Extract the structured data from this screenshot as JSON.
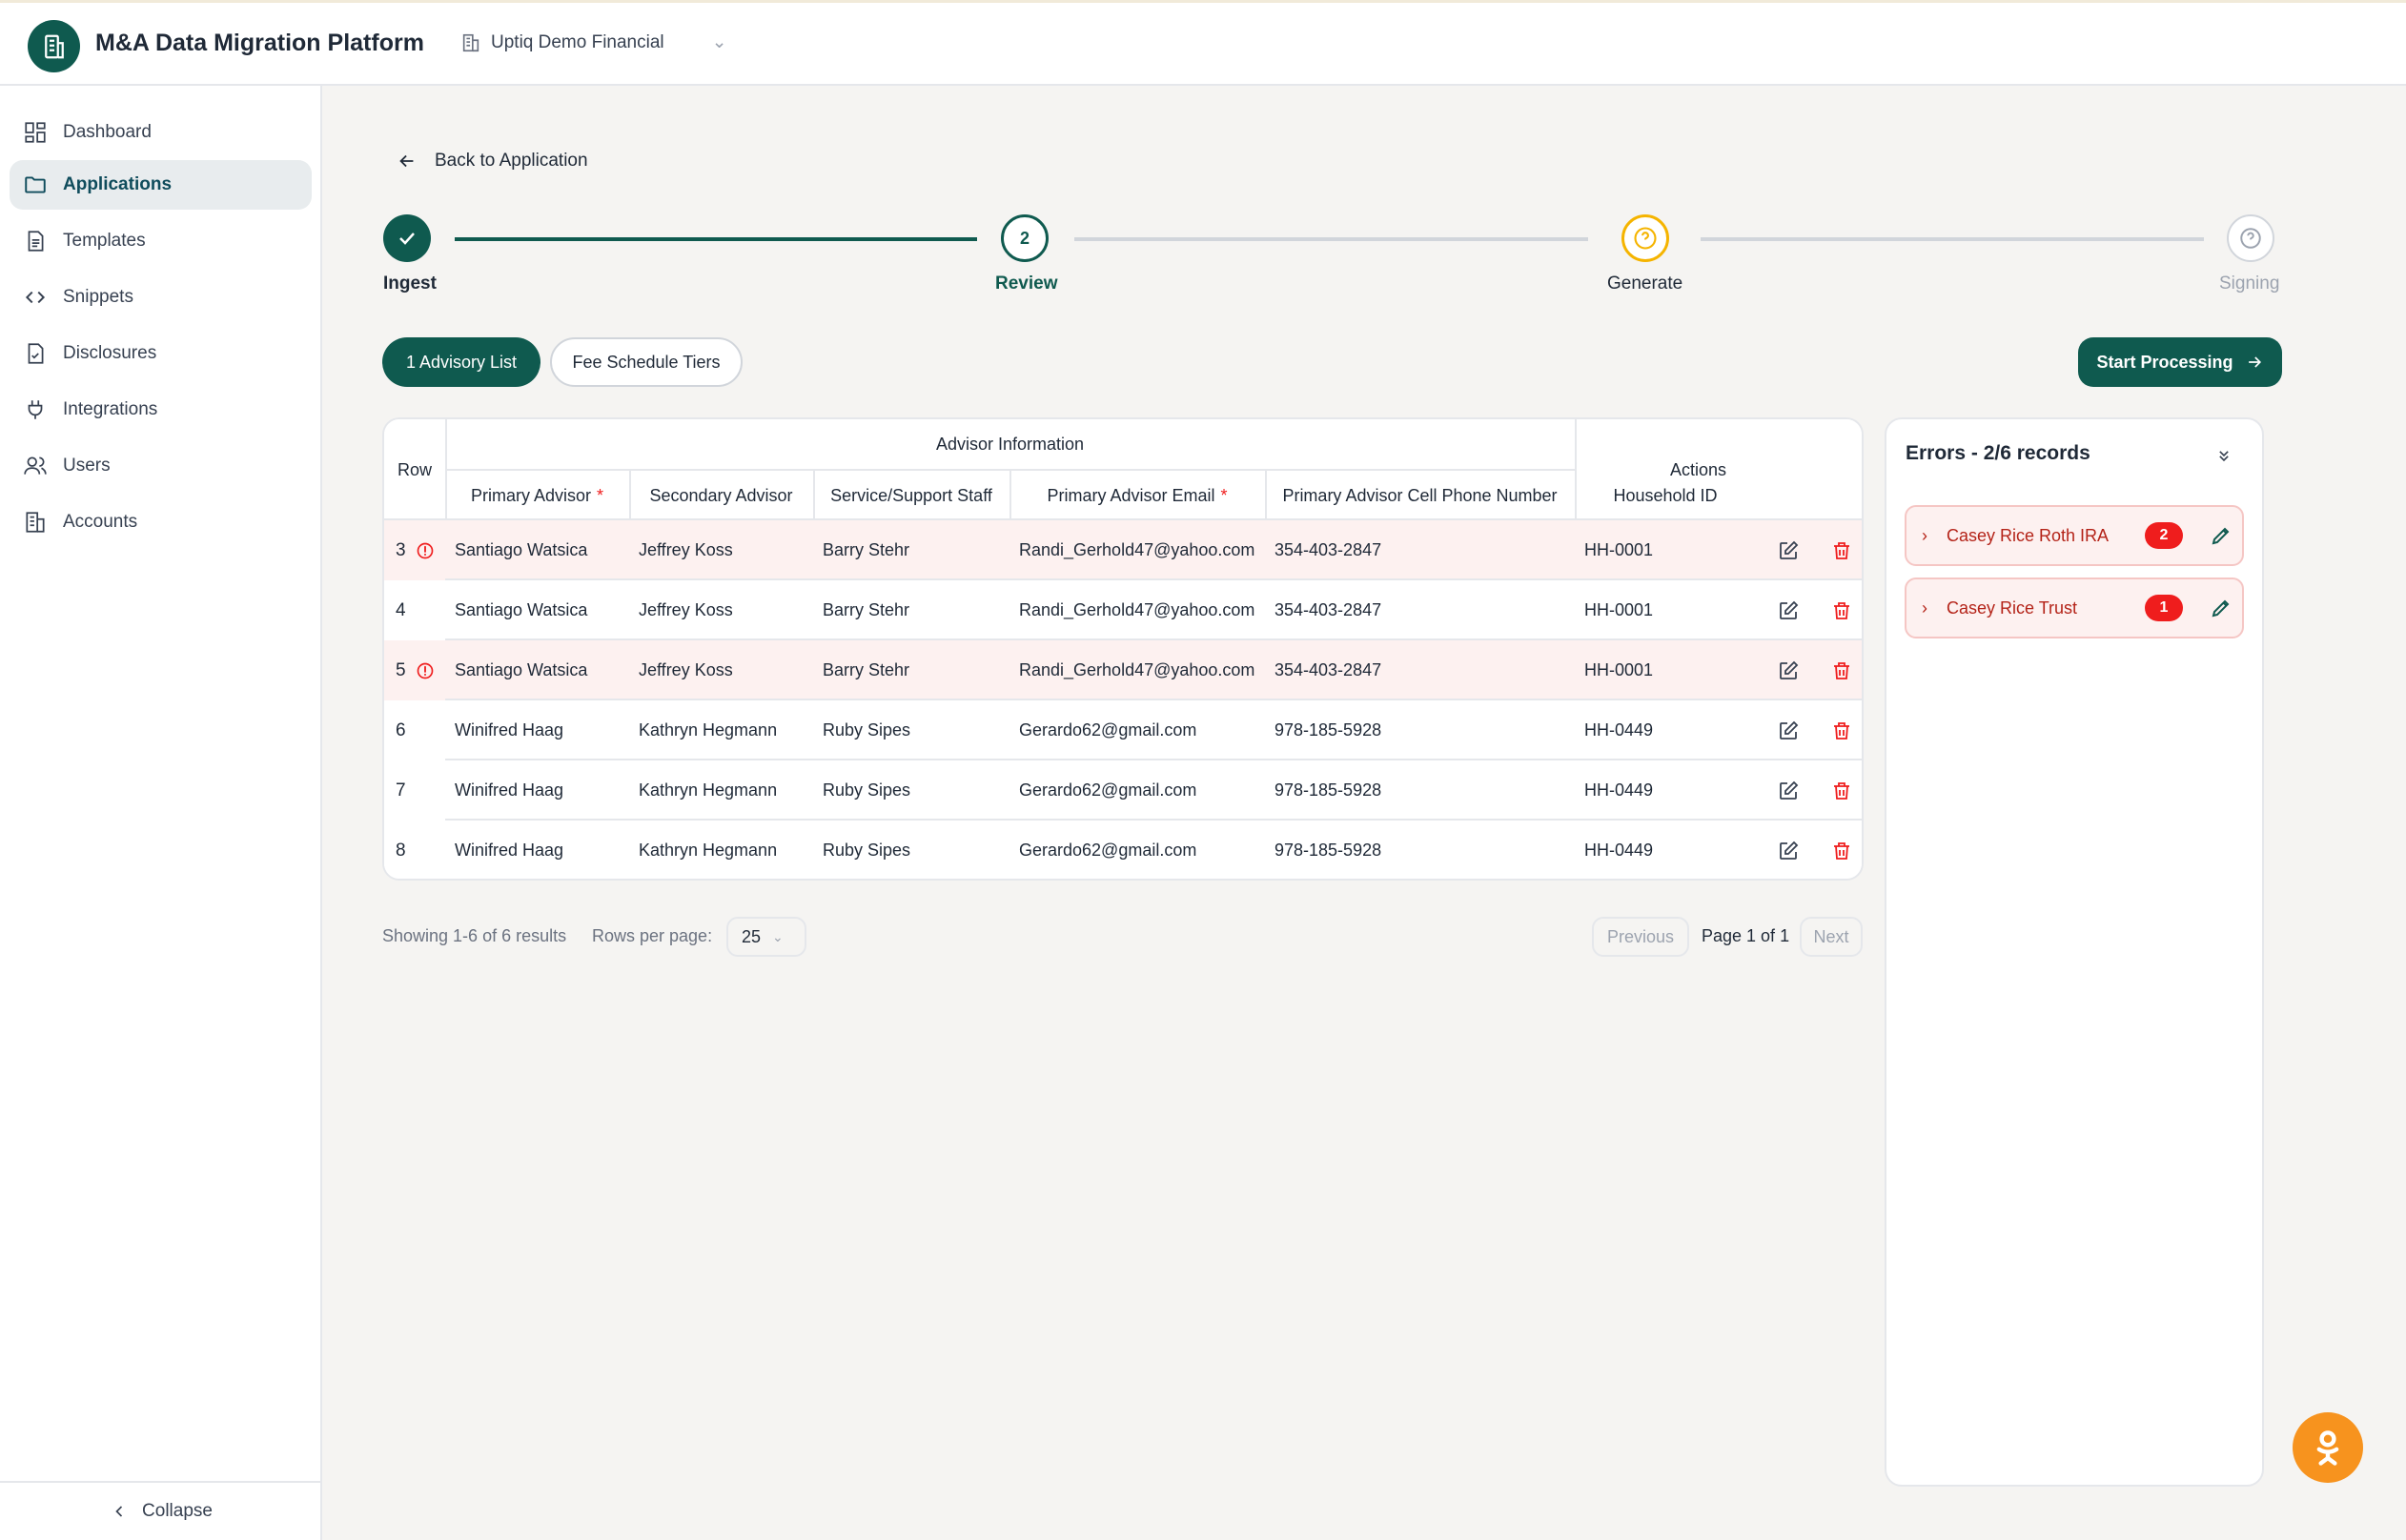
{
  "app": {
    "title": "M&A Data Migration Platform",
    "org": "Uptiq Demo Financial"
  },
  "sidebar": {
    "items": [
      {
        "label": "Dashboard",
        "icon": "dashboard-icon"
      },
      {
        "label": "Applications",
        "icon": "folder-icon",
        "active": true
      },
      {
        "label": "Templates",
        "icon": "document-icon"
      },
      {
        "label": "Snippets",
        "icon": "code-icon"
      },
      {
        "label": "Disclosures",
        "icon": "file-check-icon"
      },
      {
        "label": "Integrations",
        "icon": "plug-icon"
      },
      {
        "label": "Users",
        "icon": "users-icon"
      },
      {
        "label": "Accounts",
        "icon": "building-icon"
      }
    ],
    "collapse_label": "Collapse"
  },
  "back_label": "Back to Application",
  "stepper": {
    "steps": [
      {
        "label": "Ingest",
        "state": "done"
      },
      {
        "label": "Review",
        "number": "2",
        "state": "current"
      },
      {
        "label": "Generate",
        "state": "warning"
      },
      {
        "label": "Signing",
        "state": "pending"
      }
    ]
  },
  "tabs": {
    "advisory": "1 Advisory List",
    "fee": "Fee Schedule Tiers"
  },
  "start_processing": "Start Processing",
  "table": {
    "group_header": "Advisor Information",
    "row_header": "Row",
    "actions_header": "Actions",
    "columns": [
      "Primary Advisor",
      "Secondary Advisor",
      "Service/Support Staff",
      "Primary Advisor Email",
      "Primary Advisor Cell Phone Number",
      "Household ID"
    ],
    "required_mark": "*",
    "rows": [
      {
        "row": "3",
        "error": true,
        "cells": [
          "Santiago Watsica",
          "Jeffrey Koss",
          "Barry Stehr",
          "Randi_Gerhold47@yahoo.com",
          "354-403-2847",
          "HH-0001"
        ]
      },
      {
        "row": "4",
        "error": false,
        "cells": [
          "Santiago Watsica",
          "Jeffrey Koss",
          "Barry Stehr",
          "Randi_Gerhold47@yahoo.com",
          "354-403-2847",
          "HH-0001"
        ]
      },
      {
        "row": "5",
        "error": true,
        "cells": [
          "Santiago Watsica",
          "Jeffrey Koss",
          "Barry Stehr",
          "Randi_Gerhold47@yahoo.com",
          "354-403-2847",
          "HH-0001"
        ]
      },
      {
        "row": "6",
        "error": false,
        "cells": [
          "Winifred Haag",
          "Kathryn Hegmann",
          "Ruby Sipes",
          "Gerardo62@gmail.com",
          "978-185-5928",
          "HH-0449"
        ]
      },
      {
        "row": "7",
        "error": false,
        "cells": [
          "Winifred Haag",
          "Kathryn Hegmann",
          "Ruby Sipes",
          "Gerardo62@gmail.com",
          "978-185-5928",
          "HH-0449"
        ]
      },
      {
        "row": "8",
        "error": false,
        "cells": [
          "Winifred Haag",
          "Kathryn Hegmann",
          "Ruby Sipes",
          "Gerardo62@gmail.com",
          "978-185-5928",
          "HH-0449"
        ]
      }
    ]
  },
  "pagination": {
    "showing": "Showing 1-6 of 6 results",
    "rows_per_page_label": "Rows per page:",
    "rows_per_page": "25",
    "previous": "Previous",
    "page": "Page 1 of 1",
    "next": "Next"
  },
  "errors": {
    "title": "Errors - 2/6 records",
    "items": [
      {
        "label": "Casey Rice Roth IRA",
        "count": "2"
      },
      {
        "label": "Casey Rice Trust",
        "count": "1"
      }
    ]
  },
  "colors": {
    "brand": "#0f5a4f",
    "error": "#ef1d1d",
    "warning": "#f5b400",
    "fab": "#f7931e"
  }
}
